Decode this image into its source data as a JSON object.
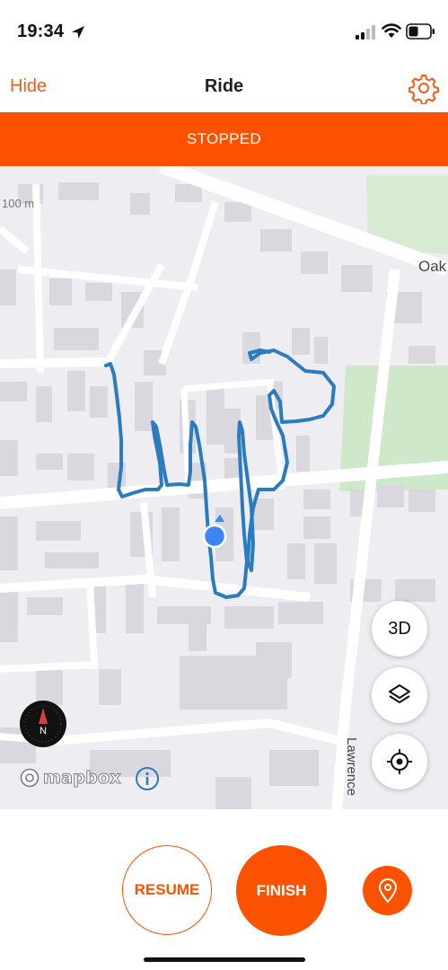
{
  "status_bar": {
    "time": "19:34",
    "icons": [
      "location-arrow-icon",
      "cellular-signal-icon",
      "wifi-icon",
      "battery-icon"
    ]
  },
  "nav": {
    "hide_label": "Hide",
    "title": "Ride",
    "settings_icon": "gear-icon"
  },
  "banner": {
    "status": "STOPPED"
  },
  "map": {
    "scale_label": "100 m",
    "streets": {
      "oak": "Oak",
      "lawrence": "Lawrence"
    },
    "buttons": {
      "three_d": "3D",
      "layers_icon": "layers-icon",
      "locate_icon": "crosshair-icon"
    },
    "compass_label": "N",
    "attribution": "mapbox",
    "route_color": "#2b7bc0",
    "location_color": "#3d86f0"
  },
  "controls": {
    "resume_label": "RESUME",
    "finish_label": "FINISH",
    "pin_icon": "map-pin-icon"
  },
  "colors": {
    "accent": "#fc5200",
    "nav_accent": "#f25c19"
  }
}
